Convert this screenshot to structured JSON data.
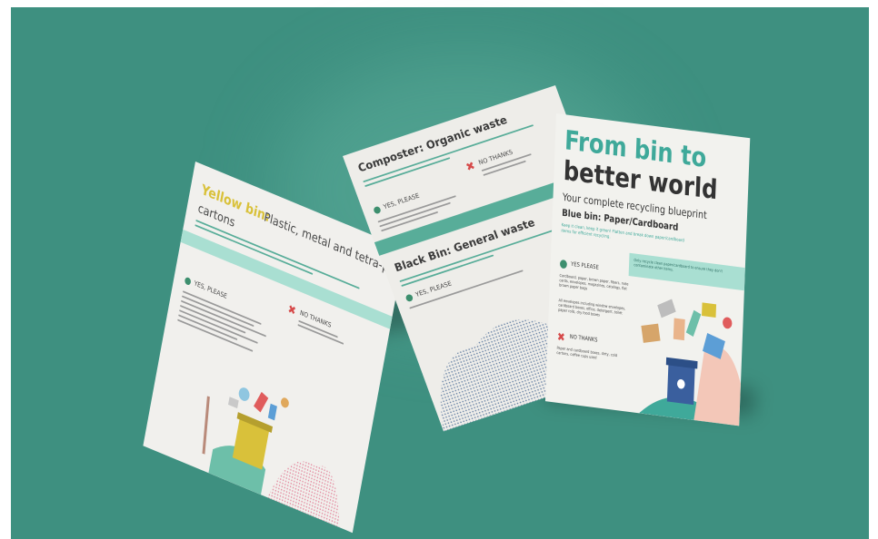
{
  "colors": {
    "background": "#3e9080",
    "paper": "#f2f2ee",
    "accent_teal": "#3fa99a",
    "accent_light": "#a9dfd2",
    "accent_yellow": "#d9c13a",
    "text_dark": "#3a3a3a",
    "no_red": "#d64a4a"
  },
  "left_panel": {
    "title_highlight": "Yellow bin:",
    "title_rest": "Plastic, metal and tetra-pak",
    "title_line2": "cartons",
    "yes_label": "YES, PLEASE",
    "no_label": "NO THANKS"
  },
  "middle_panel": {
    "compost_title": "Composter: Organic waste",
    "yes_label": "YES, PLEASE",
    "no_label": "NO THANKS",
    "black_title": "Black Bin: General waste",
    "black_yes_label": "YES, PLEASE"
  },
  "front_cover": {
    "title_line1": "From bin to",
    "title_line2": "better world",
    "subtitle": "Your complete recycling blueprint",
    "section_title": "Blue bin: Paper/Cardboard",
    "intro": "Keep it clean, keep it green! Flatten and break down paper/cardboard items for efficient recycling.",
    "yes_label": "YES PLEASE",
    "yes_text": "Cardboard, paper, brown paper, fibers, note cards, envelopes, magazines, catalogs, flat brown paper bags",
    "yes_text2": "All envelopes including window envelopes, cardboard boxes, office, detergent, toilet paper rolls, dry food boxes",
    "no_label": "NO THANKS",
    "no_text": "Paper and cardboard boxes, dirty, cold cartons, coffee cups used",
    "band_text": "Only recycle clean paper/cardboard to ensure they don't contaminate other items."
  }
}
